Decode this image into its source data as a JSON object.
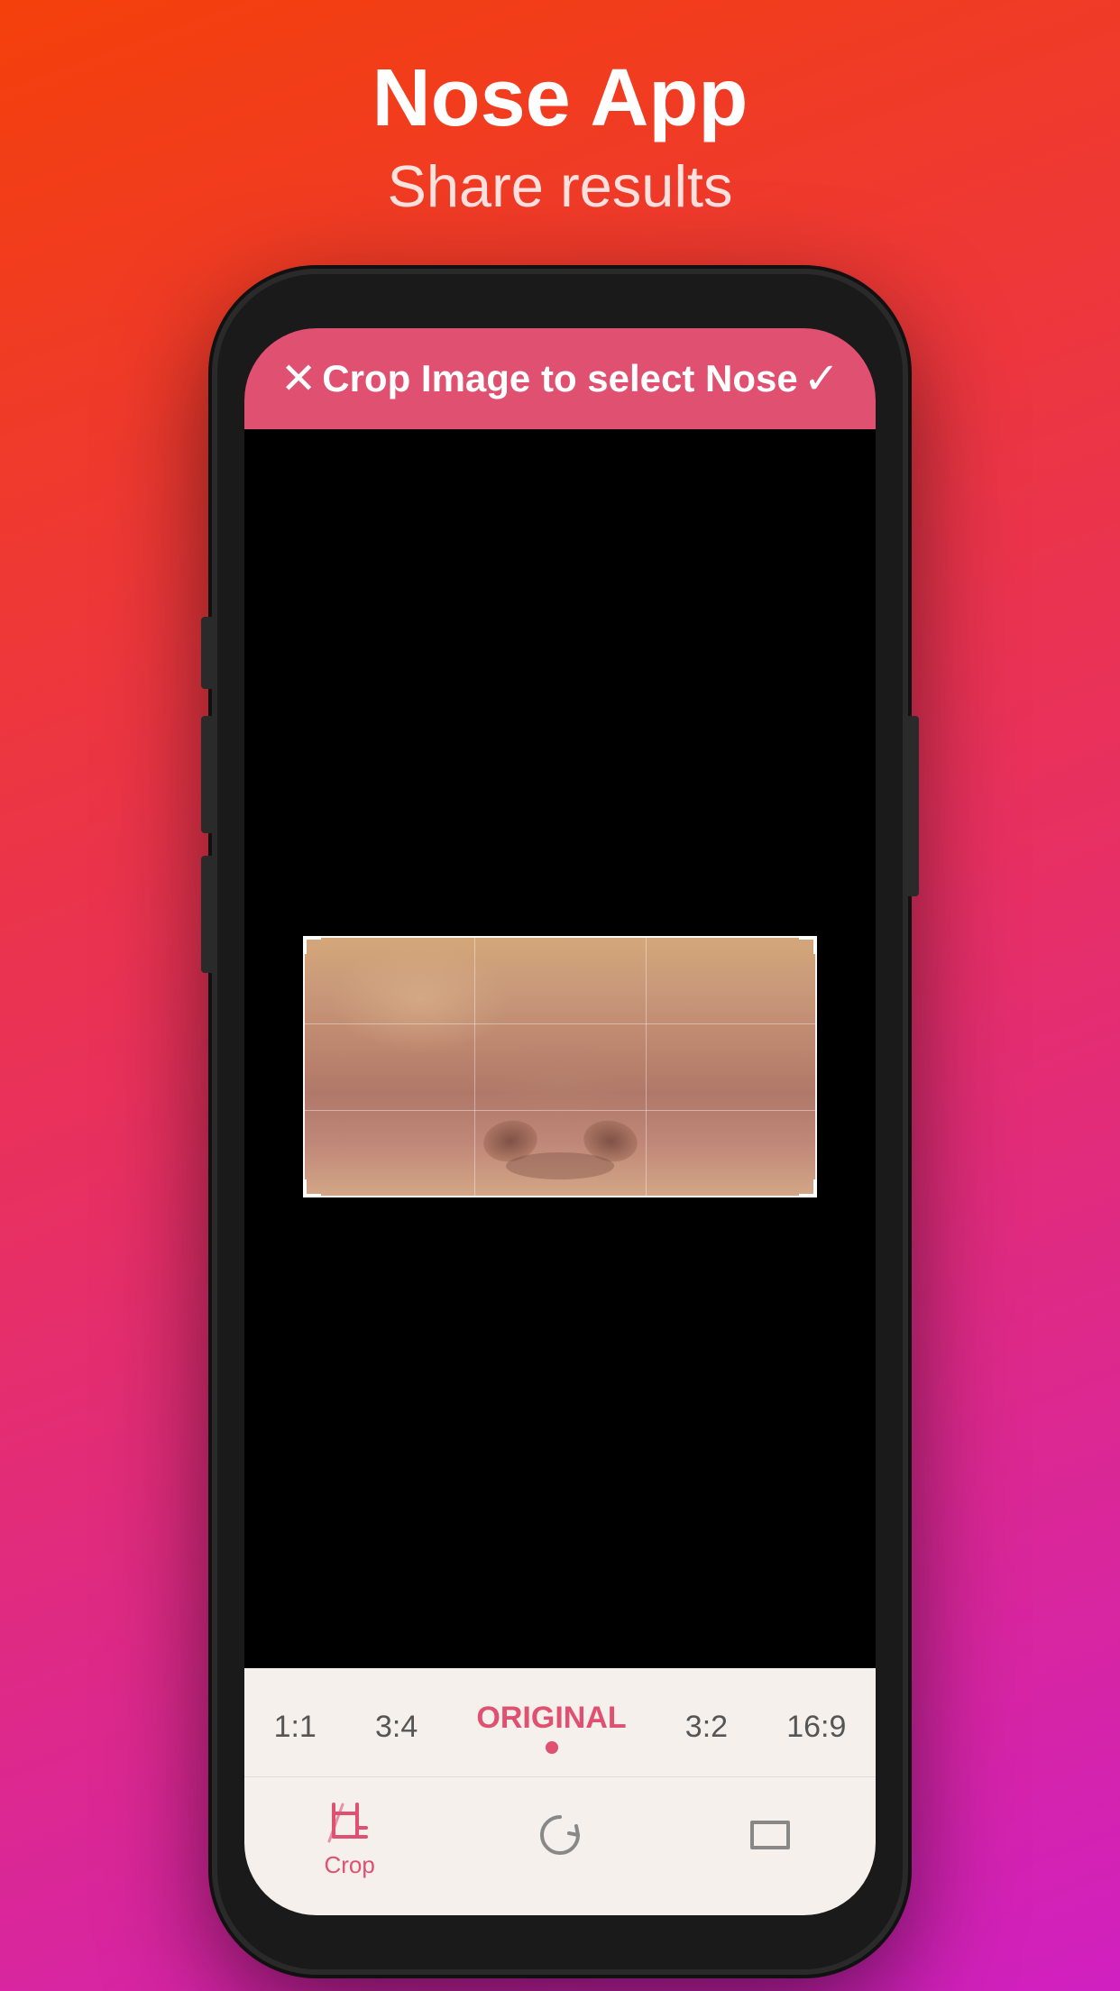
{
  "header": {
    "title": "Nose App",
    "subtitle": "Share results"
  },
  "phone": {
    "crop_bar": {
      "title": "Crop Image to select Nose",
      "close_icon": "✕",
      "confirm_icon": "✓"
    },
    "ratio_options": [
      {
        "label": "1:1",
        "active": false
      },
      {
        "label": "3:4",
        "active": false
      },
      {
        "label": "ORIGINAL",
        "active": true
      },
      {
        "label": "3:2",
        "active": false
      },
      {
        "label": "16:9",
        "active": false
      }
    ],
    "toolbar": {
      "items": [
        {
          "label": "Crop",
          "active": true
        },
        {
          "label": "",
          "active": false
        },
        {
          "label": "",
          "active": false
        }
      ]
    }
  },
  "colors": {
    "accent": "#e05070",
    "bg_gradient_start": "#f4400a",
    "bg_gradient_end": "#d020c0",
    "phone_shell": "#1a1a1a",
    "screen_bg": "#000000",
    "ratio_bar_bg": "#f5f0ec"
  }
}
